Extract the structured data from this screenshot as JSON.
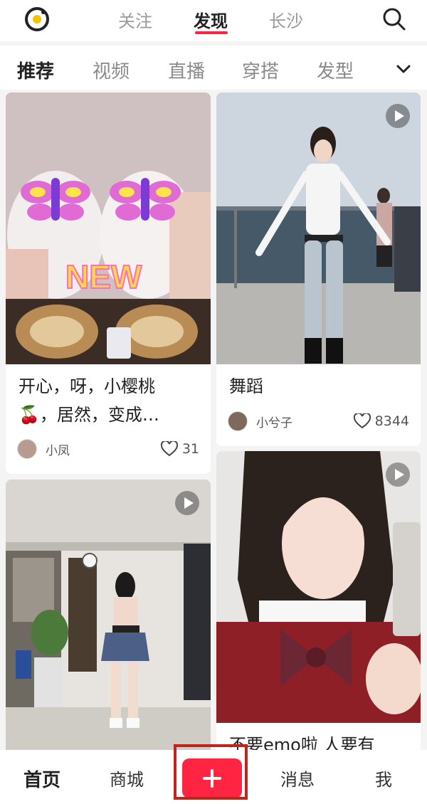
{
  "header": {
    "tabs": [
      {
        "label": "关注"
      },
      {
        "label": "发现"
      },
      {
        "label": "长沙"
      }
    ],
    "active_tab": "发现",
    "icons": {
      "logo": "camera-logo-icon",
      "search": "search-icon"
    }
  },
  "categories": {
    "items": [
      {
        "label": "推荐"
      },
      {
        "label": "视频"
      },
      {
        "label": "直播"
      },
      {
        "label": "穿搭"
      },
      {
        "label": "发型"
      }
    ],
    "active": "推荐",
    "expand_icon": "chevron-down-icon"
  },
  "feed": {
    "cards": [
      {
        "title_line1": "开心，呀，小樱桃",
        "title_line2": "🍒，居然，变成…",
        "author": "小凤",
        "likes": "31",
        "is_video": false
      },
      {
        "title_line1": "舞蹈",
        "author": "小兮子",
        "likes": "8344",
        "is_video": true
      },
      {
        "title_line1": "",
        "is_video": true
      },
      {
        "title_line1": "不要emo啦 人要有",
        "is_video": true
      }
    ]
  },
  "bottom_nav": {
    "items": [
      {
        "label": "首页"
      },
      {
        "label": "商城"
      },
      {
        "label": "消息"
      },
      {
        "label": "我"
      }
    ],
    "active": "首页",
    "add_icon": "plus-icon"
  },
  "colors": {
    "accent": "#ff2442",
    "highlight_box": "#c0241a"
  }
}
